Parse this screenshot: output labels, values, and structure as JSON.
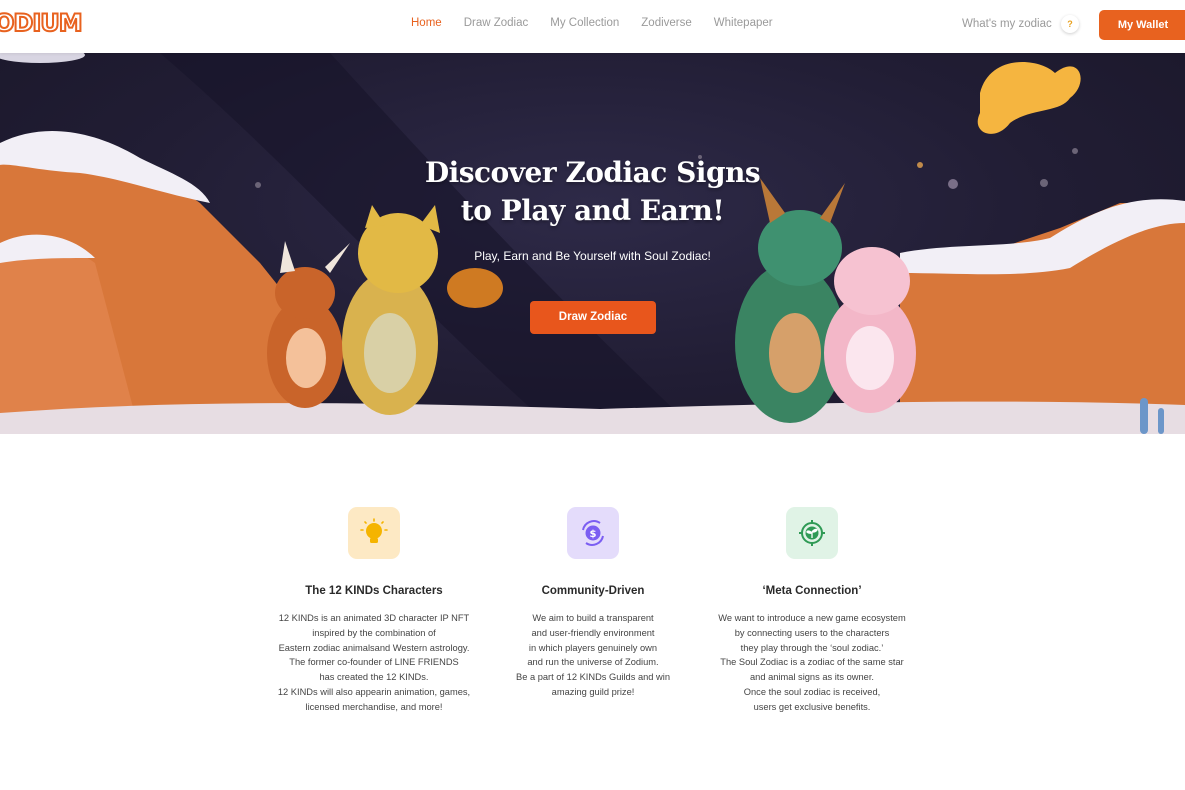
{
  "nav": {
    "logo": "ODIUM",
    "links": [
      "Home",
      "Draw Zodiac",
      "My Collection",
      "Zodiverse",
      "Whitepaper"
    ],
    "active_index": 0,
    "whats_my_zodiac": "What's my zodiac",
    "help_icon_text": "?",
    "wallet_label": "My Wallet"
  },
  "hero": {
    "title_line1": "Discover Zodiac Signs",
    "title_line2": "to Play and Earn!",
    "subtitle": "Play, Earn and Be Yourself with Soul Zodiac!",
    "cta_label": "Draw Zodiac"
  },
  "features": [
    {
      "icon": "lightbulb-icon",
      "icon_bg": "#fde9c4",
      "title": "The 12 KINDs Characters",
      "description": "12 KINDs is an animated 3D character IP NFT\ninspired by the combination of\nEastern zodiac animalsand Western astrology.\nThe former co-founder of LINE FRIENDS\nhas created the 12 KINDs.\n12 KINDs will also appearin animation, games,\nlicensed merchandise, and more!"
    },
    {
      "icon": "coin-cycle-icon",
      "icon_bg": "#e4dcfb",
      "title": "Community-Driven",
      "description": "We aim to build a transparent\nand user-friendly environment\nin which players genuinely own\nand run the universe of Zodium.\nBe a part of 12 KINDs Guilds and win\namazing guild prize!"
    },
    {
      "icon": "plant-target-icon",
      "icon_bg": "#e0f3e6",
      "title": "‘Meta Connection’",
      "description": "We want to introduce a new game ecosystem\nby connecting users to the characters\nthey play through the ‘soul zodiac.’\nThe Soul Zodiac is a zodiac of the same star\nand animal signs as its owner.\nOnce the soul zodiac is received,\nusers get exclusive benefits."
    }
  ],
  "colors": {
    "accent": "#e8621f",
    "hero_bg": "#211d34"
  }
}
